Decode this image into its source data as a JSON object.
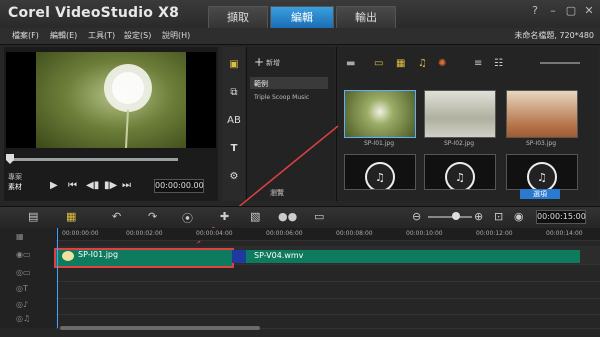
{
  "app": {
    "title": "Corel VideoStudio X8",
    "tabs": [
      "擷取",
      "編輯",
      "輸出"
    ],
    "active_tab": 1,
    "window_controls": [
      "question-icon",
      "minimize-icon",
      "maximize-icon",
      "close-icon"
    ]
  },
  "menu": {
    "items": [
      "檔案(F)",
      "編輯(E)",
      "工具(T)",
      "設定(S)",
      "說明(H)"
    ],
    "project_info": "未命名檔題, 720*480"
  },
  "player": {
    "mode_labels": [
      "專案",
      "素材"
    ],
    "timecode": "00:00:00.00",
    "controls": [
      "play-icon",
      "home-icon",
      "prev-frame-icon",
      "next-frame-icon",
      "end-icon"
    ]
  },
  "library": {
    "add_label": "新增",
    "category_item": "範例",
    "sub_item": "Triple Scoop Music",
    "footer_label": "瀏覽",
    "options_label": "選項",
    "thumbnails": [
      {
        "label": "SP-I01.jpg"
      },
      {
        "label": "SP-I02.jpg"
      },
      {
        "label": "SP-I03.jpg"
      },
      {
        "label": ""
      },
      {
        "label": ""
      },
      {
        "label": ""
      }
    ]
  },
  "timeline": {
    "time": "00:00:15:00",
    "ruler_ticks": [
      "00:00:00:00",
      "00:00:02:00",
      "00:00:04:00",
      "00:00:06:00",
      "00:00:08:00",
      "00:00:10:00",
      "00:00:12:00",
      "00:00:14:00"
    ],
    "clips": [
      {
        "name": "SP-I01.jpg"
      },
      {
        "name": "SP-V04.wmv"
      }
    ]
  },
  "colors": {
    "accent": "#2a8ad0",
    "clip": "#0e7a5e",
    "highlight": "#e04040"
  }
}
